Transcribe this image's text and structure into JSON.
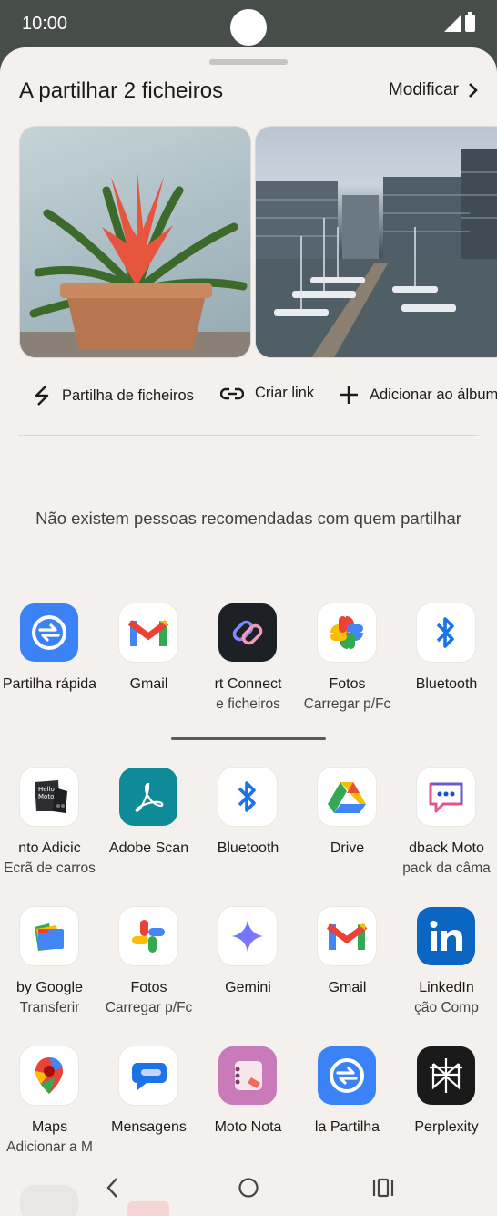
{
  "status_bar": {
    "time": "10:00"
  },
  "sheet": {
    "title": "A partilhar 2 ficheiros",
    "modify_label": "Modificar"
  },
  "actions": [
    {
      "label": "Partilha de ficheiros",
      "icon": "file-sharing-icon"
    },
    {
      "label": "Criar link",
      "icon": "link-icon"
    },
    {
      "label": "Adicionar ao álbum",
      "icon": "plus-icon"
    }
  ],
  "empty_message": "Não existem pessoas recomendadas com quem partilhar",
  "direct_share": [
    {
      "label": "Partilha rápida",
      "sublabel": "",
      "icon": "quick-share-icon"
    },
    {
      "label": "Gmail",
      "sublabel": "",
      "icon": "gmail-icon"
    },
    {
      "label": "rt Connect",
      "sublabel": "e ficheiros",
      "icon": "smart-connect-icon"
    },
    {
      "label": "Fotos",
      "sublabel": "Carregar p/Fc",
      "icon": "photos-icon"
    },
    {
      "label": "Bluetooth",
      "sublabel": "",
      "icon": "bluetooth-icon"
    }
  ],
  "app_rows": [
    [
      {
        "label": "nto      Adicic",
        "sublabel": "Ecrã de carros",
        "icon": "hello-moto-icon"
      },
      {
        "label": "Adobe Scan",
        "sublabel": "",
        "icon": "adobe-scan-icon"
      },
      {
        "label": "Bluetooth",
        "sublabel": "",
        "icon": "bluetooth-icon"
      },
      {
        "label": "Drive",
        "sublabel": "",
        "icon": "drive-icon"
      },
      {
        "label": "dback Moto",
        "sublabel": "pack da câma",
        "icon": "feedback-icon"
      }
    ],
    [
      {
        "label": "by Google",
        "sublabel": "Transferir",
        "icon": "files-icon"
      },
      {
        "label": "Fotos",
        "sublabel": "Carregar p/Fc",
        "icon": "photos-icon"
      },
      {
        "label": "Gemini",
        "sublabel": "",
        "icon": "gemini-icon"
      },
      {
        "label": "Gmail",
        "sublabel": "",
        "icon": "gmail-icon"
      },
      {
        "label": "LinkedIn",
        "sublabel": "ção     Comp",
        "icon": "linkedin-icon"
      }
    ],
    [
      {
        "label": "Maps",
        "sublabel": "Adicionar a M",
        "icon": "maps-icon"
      },
      {
        "label": "Mensagens",
        "sublabel": "",
        "icon": "messages-icon"
      },
      {
        "label": "Moto Nota",
        "sublabel": "",
        "icon": "moto-note-icon"
      },
      {
        "label": "la       Partilha",
        "sublabel": "",
        "icon": "quick-share-icon"
      },
      {
        "label": "Perplexity",
        "sublabel": "",
        "icon": "perplexity-icon"
      }
    ]
  ],
  "colors": {
    "status_bar": "#474d49",
    "sheet_background": "#f3f0ed",
    "quick_share_blue": "#3b82f6",
    "linkedin_blue": "#0a66c2",
    "adobe_teal": "#0e8a99"
  }
}
